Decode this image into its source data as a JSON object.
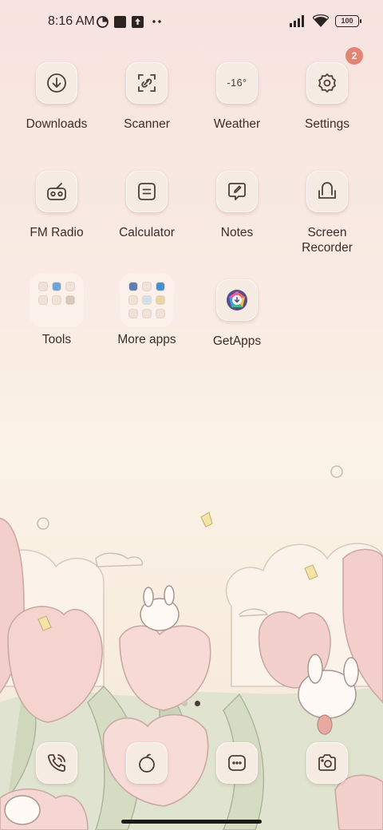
{
  "status_bar": {
    "time": "8:16 AM",
    "battery": "100",
    "left_icons": [
      "data-saver-icon",
      "square-notification-icon",
      "upload-icon",
      "more-dots-icon"
    ],
    "right_icons": [
      "signal-icon",
      "wifi-icon",
      "battery-icon"
    ]
  },
  "apps": [
    {
      "label": "Downloads",
      "icon": "download-icon"
    },
    {
      "label": "Scanner",
      "icon": "scan-icon"
    },
    {
      "label": "Weather",
      "icon": "weather-icon",
      "temp": "-16°"
    },
    {
      "label": "Settings",
      "icon": "gear-icon",
      "badge": "2"
    },
    {
      "label": "FM Radio",
      "icon": "radio-icon"
    },
    {
      "label": "Calculator",
      "icon": "calculator-icon"
    },
    {
      "label": "Notes",
      "icon": "notes-icon"
    },
    {
      "label": "Screen Recorder",
      "icon": "screen-recorder-icon"
    },
    {
      "label": "Tools",
      "icon": "folder-icon"
    },
    {
      "label": "More apps",
      "icon": "folder-icon"
    },
    {
      "label": "GetApps",
      "icon": "getapps-icon"
    }
  ],
  "dock": [
    {
      "icon": "phone-icon"
    },
    {
      "icon": "browser-icon"
    },
    {
      "icon": "messages-icon"
    },
    {
      "icon": "camera-icon"
    }
  ],
  "pages": {
    "count": 2,
    "active": 2
  },
  "colors": {
    "badge": "#e28474",
    "icon_bg": "#f6ebe3",
    "icon_stroke": "#4d3e37"
  }
}
